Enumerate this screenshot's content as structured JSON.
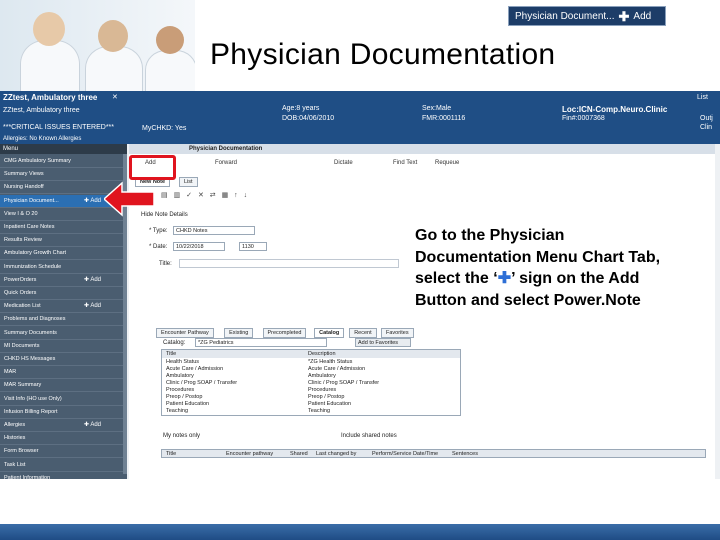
{
  "slide": {
    "title": "Physician Documentation",
    "top_button": {
      "label": "Physician Document...",
      "plus": "✚",
      "add_label": "Add"
    },
    "callout": {
      "line1": "Go to the Physician",
      "line2": "Documentation Menu Chart Tab,",
      "line3_before": "select the ‘",
      "line3_plus": "✚",
      "line3_after": "’ sign on the Add",
      "line4": "Button and select Power.Note"
    }
  },
  "patient_banner": {
    "name": "ZZtest, Ambulatory three",
    "name2": "ZZtest, Ambulatory three",
    "close": "✕",
    "age": "Age:8 years",
    "dob": "DOB:04/06/2010",
    "sex": "Sex:Male",
    "mrn": "FMR:0001116",
    "loc": "Loc:ICN-Comp.Neuro.Clinic",
    "fin": "Fin#:0007368",
    "critical": "***CRITICAL ISSUES ENTERED***",
    "allergies": "Allergies: No Known Allergies",
    "mychkd": "MyCHKD: Yes",
    "list": "List",
    "right_cut1": "Outj",
    "right_cut2": "Clin"
  },
  "menu": {
    "header": "Menu",
    "add_label": "✚ Add",
    "items": [
      "CMG Ambulatory Summary",
      "Summary Views",
      "Nursing Handoff",
      "Physician Document...",
      "View I & O 20",
      "Inpatient Care Notes",
      "Results Review",
      "Ambulatory Growth Chart",
      "Immunization Schedule",
      "PowerOrders",
      "Quick Orders",
      "Medication List",
      "Problems and Diagnoses",
      "Summary Documents",
      "MI Documents",
      "CHKD HS Messages",
      "MAR",
      "MAR Summary",
      "Visit Info (HO use Only)",
      "Infusion Billing Report",
      "Allergies",
      "Histories",
      "Form Browser",
      "Task List",
      "Patient Information"
    ]
  },
  "content": {
    "header": "Physician Documentation",
    "toolbar": {
      "add": "Add",
      "forward": "Forward",
      "dictate": "Dictate",
      "find_text": "Find Text",
      "requeue": "Requeue"
    },
    "tabs": [
      "New Note",
      "List"
    ],
    "hide_note_details": "Hide Note Details",
    "type_label": "* Type:",
    "type_value": "CHKD Notes",
    "date_label": "* Date:",
    "date_value": "10/22/2018",
    "time_value": "1130",
    "title_label": "Title:",
    "note_tabs": [
      "Encounter Pathway",
      "Existing",
      "Precompleted",
      "Catalog",
      "Recent",
      "Favorites"
    ],
    "catalog_label": "Catalog:",
    "catalog_value": "*ZG Pediatrics",
    "add_favorites": "Add to Favorites",
    "tree_col1": "Title",
    "tree_col2": "Description",
    "tree_items": [
      [
        "Health Status",
        "*ZG Health Status"
      ],
      [
        "Acute Care / Admission",
        "Acute Care / Admission"
      ],
      [
        "Ambulatory",
        "Ambulatory"
      ],
      [
        "Clinic / Prog SOAP / Transfer",
        "Clinic / Prog SOAP / Transfer"
      ],
      [
        "Procedures",
        "Procedures"
      ],
      [
        "Preop / Postop",
        "Preop / Postop"
      ],
      [
        "Patient Education",
        "Patient Education"
      ],
      [
        "Teaching",
        "Teaching"
      ]
    ],
    "my_notes_only": "My notes only",
    "include_shared": "Include shared notes",
    "list_cols": [
      "Title",
      "Encounter pathway",
      "Shared",
      "Last changed by",
      "Perform/Service Date/Time",
      "Sentences"
    ]
  },
  "colors": {
    "banner": "#1f4e85",
    "menu": "#4a5d70",
    "selected": "#2b6fb3",
    "highlight": "#e0141e",
    "plus_blue": "#2e6fd6"
  }
}
